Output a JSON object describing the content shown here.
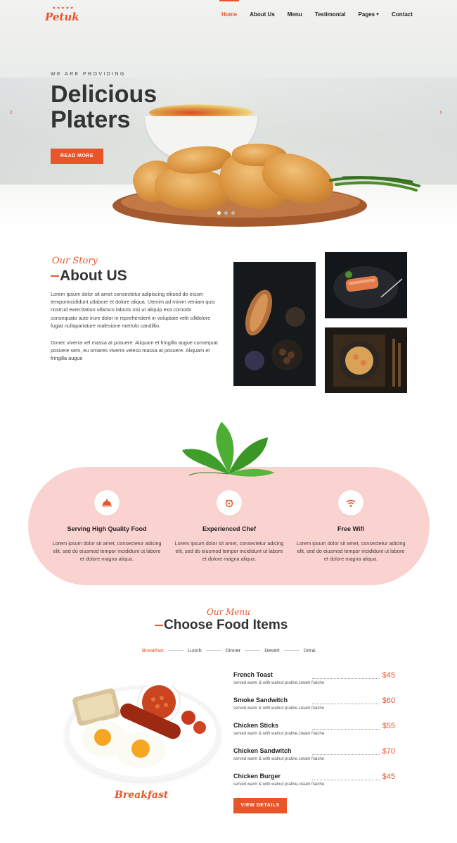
{
  "brand": {
    "name": "Petuk",
    "stars": "★★★★★"
  },
  "nav": {
    "items": [
      {
        "label": "Home",
        "active": true
      },
      {
        "label": "About Us"
      },
      {
        "label": "Menu"
      },
      {
        "label": "Testimonial"
      },
      {
        "label": "Pages"
      },
      {
        "label": "Contact"
      }
    ]
  },
  "hero": {
    "kicker": "WE ARE PROVIDING",
    "title": "Delicious Platers",
    "button": "READ MORE",
    "prev": "‹",
    "next": "›"
  },
  "about": {
    "script": "Our Story",
    "title": "About US",
    "p1": "Lorem ipsum dolor sit amet consectetur adipiscing elitsed do eiusm temporincididunt utlabore et dolore aliqua. Utenim ad minim veniam quis nostrud exercitation ullamco laboris nisi ut aliquip exa comodo consequato aute irure dolor in reprehenderit in voluptate velit cilldolore fugiat nullapariature malesione mertolo candillio.",
    "p2": "Donec viverra vel massa at posuere. Aliquam et fringilla augue consequat posuere sem, eu ornares viverra veleso massa at posuere. Aliquam et fringilla augue"
  },
  "features": [
    {
      "title": "Serving High Quality Food",
      "text": "Lorem ipsum dolor sit amet, consectetur adicing elit, sed do eiusmod tempor incididunt ut labore et dolore magna aliqua.",
      "icon": "cloche-icon"
    },
    {
      "title": "Experienced Chef",
      "text": "Lorem ipsum dolor sit amet, consectetur adicing elit, sed do eiusmod tempor incididunt ut labore et dolore magna aliqua.",
      "icon": "chef-icon"
    },
    {
      "title": "Free Wifi",
      "text": "Lorem ipsum dolor sit amet, consectetur adicing elit, sed do eiusmod tempor incididunt ut labore et dolore magna aliqua.",
      "icon": "wifi-icon"
    }
  ],
  "menu": {
    "script": "Our Menu",
    "title": "Choose Food Items",
    "tabs": [
      {
        "label": "Breakfast",
        "active": true
      },
      {
        "label": "Lunch"
      },
      {
        "label": "Dinner"
      },
      {
        "label": "Desert"
      },
      {
        "label": "Drink"
      }
    ],
    "plate_label": "Breakfast",
    "items": [
      {
        "name": "French Toast",
        "desc": "served warm & with walnut praline,cream fraiche",
        "price": "$45"
      },
      {
        "name": "Smoke Sandwitch",
        "desc": "served warm & with walnut praline,cream fraiche",
        "price": "$60"
      },
      {
        "name": "Chicken Sticks",
        "desc": "served warm & with walnut praline,cream fraiche",
        "price": "$55"
      },
      {
        "name": "Chicken Sandwitch",
        "desc": "served warm & with walnut praline,cream fraiche",
        "price": "$70"
      },
      {
        "name": "Chicken Burger",
        "desc": "served warm & with walnut praline,cream fraiche",
        "price": "$45"
      }
    ],
    "button": "VIEW DETAILS"
  },
  "colors": {
    "accent": "#e8552b",
    "pill_bg": "#fad2cf",
    "text": "#333333"
  }
}
